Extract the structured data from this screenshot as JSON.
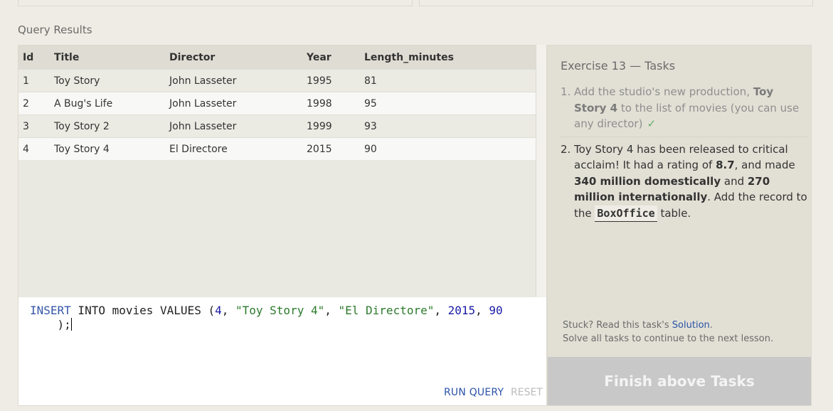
{
  "results": {
    "label": "Query Results",
    "columns": [
      "Id",
      "Title",
      "Director",
      "Year",
      "Length_minutes"
    ],
    "rows": [
      [
        "1",
        "Toy Story",
        "John Lasseter",
        "1995",
        "81"
      ],
      [
        "2",
        "A Bug's Life",
        "John Lasseter",
        "1998",
        "95"
      ],
      [
        "3",
        "Toy Story 2",
        "John Lasseter",
        "1999",
        "93"
      ],
      [
        "4",
        "Toy Story 4",
        "El Directore",
        "2015",
        "90"
      ]
    ]
  },
  "editor": {
    "code": {
      "kw_insert": "INSERT",
      "plain_1": " INTO movies VALUES (",
      "n1": "4",
      "sep1": ", ",
      "s1": "\"Toy Story 4\"",
      "sep2": ", ",
      "s2": "\"El Directore\"",
      "sep3": ", ",
      "n2": "2015",
      "sep4": ", ",
      "n3": "90",
      "tail": "\n    );"
    },
    "run_label": "RUN QUERY",
    "reset_label": "RESET"
  },
  "tasks": {
    "heading": "Exercise 13 — Tasks",
    "items": [
      {
        "number": "1.",
        "t1": "Add the studio's new production, ",
        "b1": "Toy Story 4",
        "t2": " to the list of movies (you can use any director)",
        "check": "✓"
      },
      {
        "number": "2.",
        "t1": "Toy Story 4 has been released to critical acclaim! It had a rating of ",
        "b1": "8.7",
        "t2": ", and made ",
        "b2": "340 million domestically",
        "t3": " and ",
        "b3": "270 million internationally",
        "t4": ". Add the record to the ",
        "code": "BoxOffice",
        "t5": " table."
      }
    ],
    "help_prefix": "Stuck? Read this task's ",
    "solution_link": "Solution",
    "help_suffix": ".",
    "help_line2": "Solve all tasks to continue to the next lesson.",
    "finish_label": "Finish above Tasks"
  }
}
